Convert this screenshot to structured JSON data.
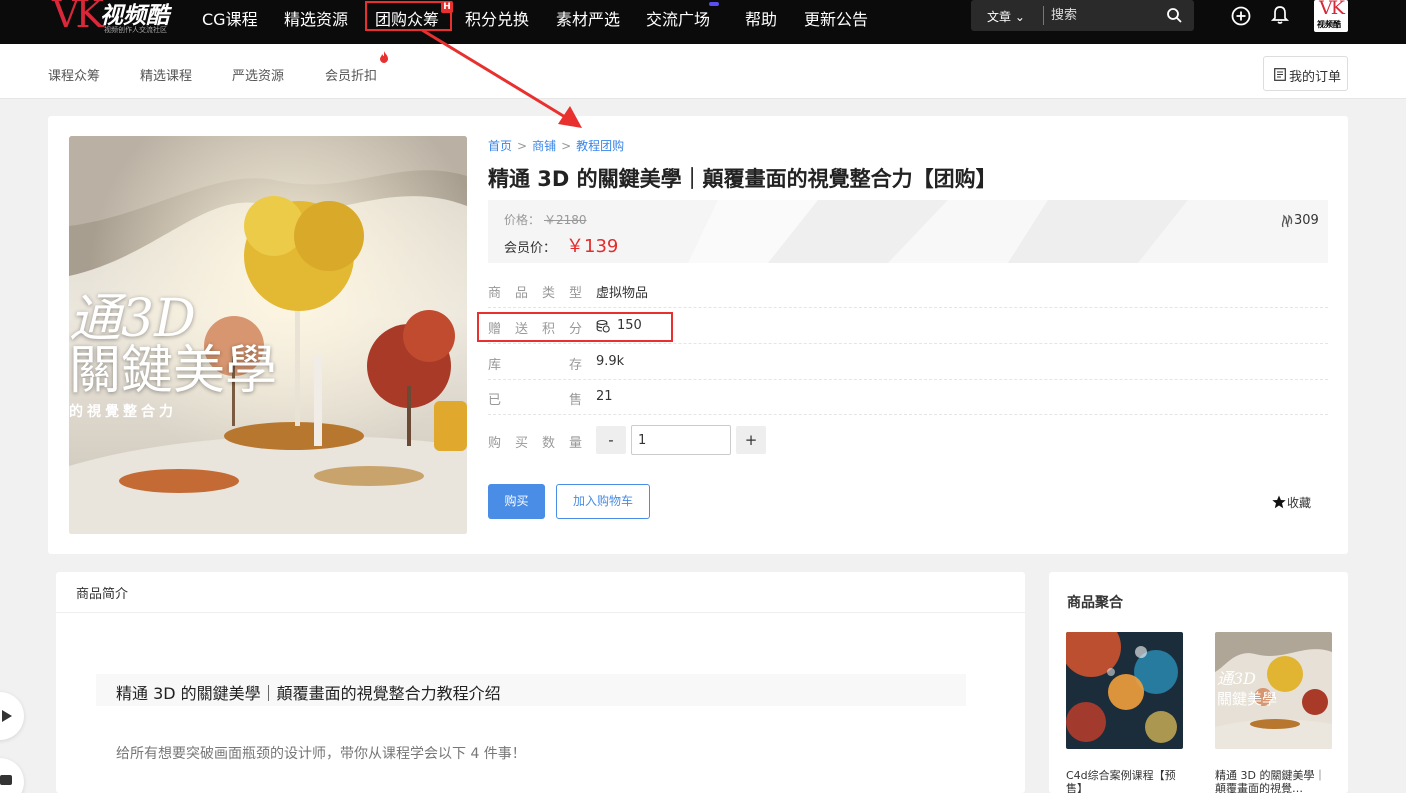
{
  "brand": {
    "logo_text": "VK",
    "logo_cn": "视频酷",
    "logo_sub": "视频创作人交流社区",
    "avatar_text": "VK",
    "avatar_cn": "视频酷",
    "accent_color": "#d8283a"
  },
  "topnav": {
    "items": [
      {
        "label": "CG课程"
      },
      {
        "label": "精选资源"
      },
      {
        "label": "团购众筹",
        "badge": "H",
        "highlighted": true
      },
      {
        "label": "积分兑换"
      },
      {
        "label": "素材严选"
      },
      {
        "label": "交流广场",
        "badge_dot": true
      },
      {
        "label": "帮助"
      },
      {
        "label": "更新公告"
      }
    ],
    "search": {
      "category": "文章",
      "placeholder": "搜索"
    },
    "icons": [
      "search-icon",
      "plus-circle-icon",
      "bell-icon"
    ]
  },
  "subnav": {
    "items": [
      {
        "label": "课程众筹"
      },
      {
        "label": "精选课程"
      },
      {
        "label": "严选资源"
      },
      {
        "label": "会员折扣",
        "hot": true
      }
    ],
    "orders_label": "我的订单"
  },
  "product": {
    "breadcrumb": [
      "首页",
      "商铺",
      "教程团购"
    ],
    "title": "精通 3D 的關鍵美學｜顛覆畫面的視覺整合力【团购】",
    "cover": {
      "line1": "通3D",
      "line2": "關鍵美學",
      "line3": "的視覺整合力"
    },
    "price_label": "价格：",
    "price_original": "￥2180",
    "member_price_label": "会员价：",
    "member_price": "￥139",
    "heat": "309",
    "attributes": {
      "type": {
        "key": "商品类型",
        "value": "虚拟物品"
      },
      "points": {
        "key": "赠送积分",
        "value": "150"
      },
      "stock": {
        "key": "库存",
        "value": "9.9k"
      },
      "sold": {
        "key": "已售",
        "value": "21"
      },
      "quantity": {
        "key": "购买数量",
        "value": "1",
        "minus": "-",
        "plus": "+"
      }
    },
    "buy_label": "购买",
    "cart_label": "加入购物车",
    "favorite_label": "收藏"
  },
  "intro": {
    "tab_label": "商品简介",
    "heading": "精通 3D 的關鍵美學｜顛覆畫面的視覺整合力教程介绍",
    "paragraph": "给所有想要突破画面瓶颈的设计师，带你从课程学会以下 4 件事！"
  },
  "aggregate": {
    "title": "商品聚合",
    "items": [
      {
        "name": "C4d综合案例课程【预售】"
      },
      {
        "name": "精通 3D 的關鍵美學｜顛覆畫面的視覺…"
      }
    ]
  }
}
